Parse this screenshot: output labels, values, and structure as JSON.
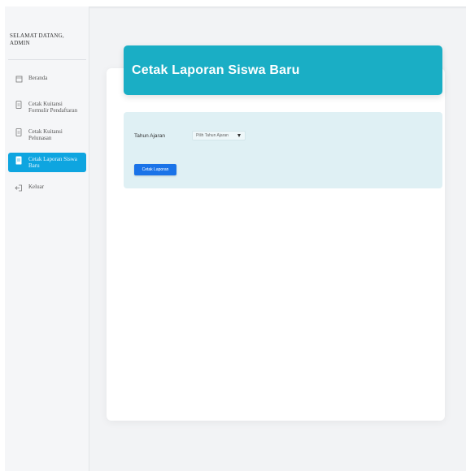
{
  "sidebar": {
    "greeting": "SELAMAT DATANG, ADMIN",
    "items": [
      {
        "label": "Beranda",
        "icon": "home-icon",
        "active": false
      },
      {
        "label": "Cetak Kuitansi Formulir Pendaftaran",
        "icon": "document-icon",
        "active": false
      },
      {
        "label": "Cetak Kuitansi Pelunasan",
        "icon": "document-icon",
        "active": false
      },
      {
        "label": "Cetak Laporan Siswa Baru",
        "icon": "document-icon",
        "active": true
      },
      {
        "label": "Keluar",
        "icon": "logout-icon",
        "active": false
      }
    ]
  },
  "main": {
    "title": "Cetak Laporan Siswa Baru",
    "filter": {
      "label": "Tahun Ajaran",
      "select_value": "Pilih Tahun Ajaran"
    },
    "submit_label": "Cetak Laporan"
  },
  "colors": {
    "banner": "#1aaec5",
    "active_nav": "#0ea5e0",
    "button": "#1a73e8",
    "filter_bg": "#dff0f4"
  }
}
